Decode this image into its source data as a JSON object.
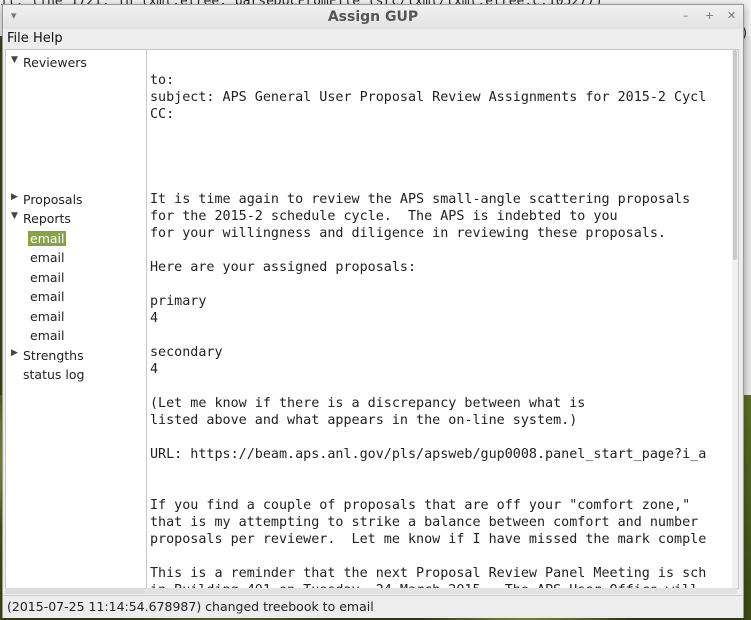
{
  "background": {
    "terminal_line": "il, line 1721, in lxml.etree._parseDocFromFile (src/lxml/lxml.etree.c:105277)",
    "terminal_right": ")"
  },
  "window": {
    "title": "Assign GUP",
    "controls": [
      "minimize-icon",
      "maximize-icon",
      "close-icon"
    ]
  },
  "menu": [
    "File",
    "Help"
  ],
  "tree": [
    {
      "label": "Reviewers",
      "expanded": true,
      "level": 0
    },
    {
      "label": "Proposals",
      "expanded": false,
      "level": 0
    },
    {
      "label": "Reports",
      "expanded": true,
      "level": 0
    },
    {
      "label": "email",
      "level": 1,
      "selected": true
    },
    {
      "label": "email",
      "level": 1
    },
    {
      "label": "email",
      "level": 1
    },
    {
      "label": "email",
      "level": 1
    },
    {
      "label": "email",
      "level": 1
    },
    {
      "label": "email",
      "level": 1
    },
    {
      "label": "Strengths",
      "expanded": false,
      "level": 0
    },
    {
      "label": "status log",
      "level": 0
    }
  ],
  "email_text": [
    "to:",
    "subject: APS General User Proposal Review Assignments for 2015-2 Cycl",
    "CC:",
    "",
    "",
    "",
    "",
    "It is time again to review the APS small-angle scattering proposals",
    "for the 2015-2 schedule cycle.  The APS is indebted to you",
    "for your willingness and diligence in reviewing these proposals.",
    "",
    "Here are your assigned proposals:",
    "",
    "primary",
    "4",
    "",
    "secondary",
    "4",
    "",
    "(Let me know if there is a discrepancy between what is",
    "listed above and what appears in the on-line system.)",
    "",
    "URL: https://beam.aps.anl.gov/pls/apsweb/gup0008.panel_start_page?i_a",
    "",
    "",
    "If you find a couple of proposals that are off your \"comfort zone,\"",
    "that is my attempting to strike a balance between comfort and number",
    "proposals per reviewer.  Let me know if I have missed the mark comple",
    "",
    "This is a reminder that the next Proposal Review Panel Meeting is sch",
    "in Building 401 on Tuesday, 24 March 2015.  The APS User Office will"
  ],
  "status": "(2015-07-25 11:14:54.678987) changed treebook to email"
}
